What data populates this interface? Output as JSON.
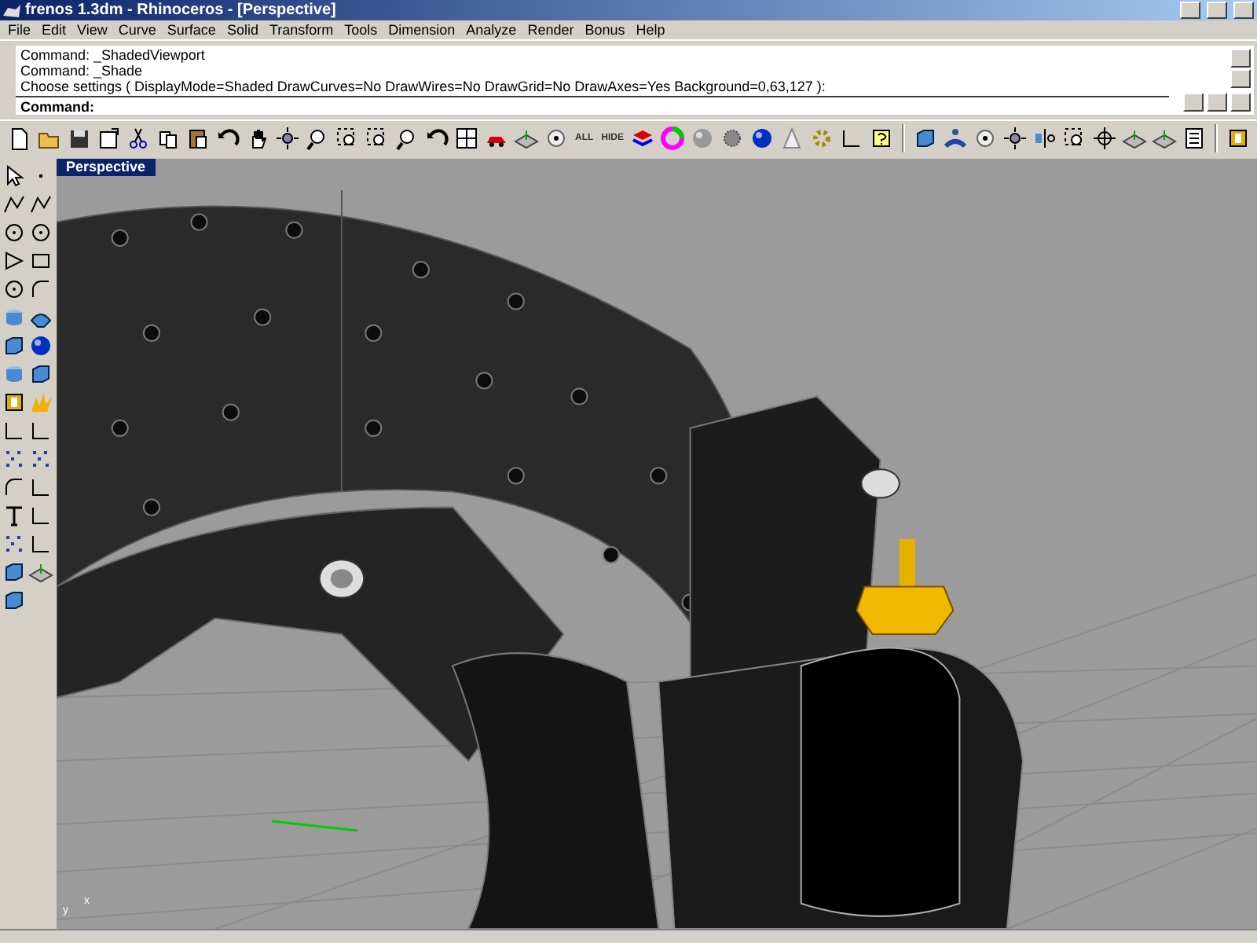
{
  "window": {
    "title": "frenos 1.3dm - Rhinoceros - [Perspective]"
  },
  "menu": [
    "File",
    "Edit",
    "View",
    "Curve",
    "Surface",
    "Solid",
    "Transform",
    "Tools",
    "Dimension",
    "Analyze",
    "Render",
    "Bonus",
    "Help"
  ],
  "command_history": [
    "Command: _ShadedViewport",
    "Command: _Shade",
    "Choose settings ( DisplayMode=Shaded  DrawCurves=No  DrawWires=No  DrawGrid=No  DrawAxes=Yes  Background=0,63,127 ):"
  ],
  "command_prompt": "Command:",
  "toolbar": {
    "text_buttons": [
      "ALL",
      "HIDE"
    ]
  },
  "viewport": {
    "title": "Perspective",
    "axis_labels": [
      "y",
      "x"
    ]
  }
}
